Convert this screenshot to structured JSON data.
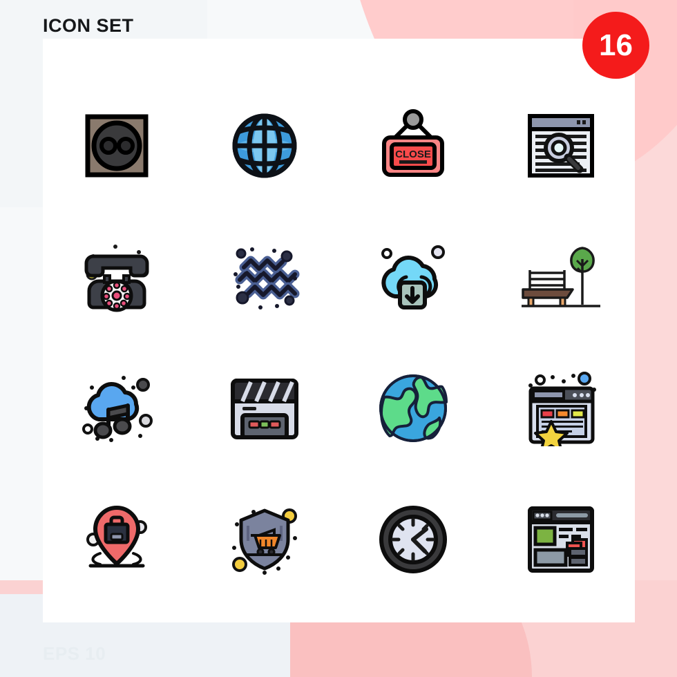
{
  "header": {
    "title": "ICON SET",
    "count_badge": "16",
    "badge_color": "#f41b1b",
    "title_color": "#16181a"
  },
  "footer": {
    "label": "EPS 10",
    "color": "#e7edf1"
  },
  "canvas": {
    "background": "#ffffff",
    "page_background": "#f7f9fa",
    "accent_pink": "#ffc9c9",
    "accent_pink_soft": "#fbd2d2",
    "columns": 4,
    "rows": 4,
    "total_icons": 16
  },
  "icons": [
    {
      "index": 1,
      "name": "power-socket-icon",
      "label": "Power Socket",
      "row": 1,
      "col": 1,
      "colors": [
        "#8a7a6d",
        "#3a3a3c",
        "#000000"
      ]
    },
    {
      "index": 2,
      "name": "globe-grid-icon",
      "label": "Globe",
      "row": 1,
      "col": 2,
      "colors": [
        "#3d9bdc",
        "#7cc8f0",
        "#0d1117"
      ]
    },
    {
      "index": 3,
      "name": "close-sign-icon",
      "label": "Close Sign",
      "row": 1,
      "col": 3,
      "colors": [
        "#fb6f6f",
        "#f94b4b",
        "#8c8c8c"
      ],
      "text": "CLOSE"
    },
    {
      "index": 4,
      "name": "browser-search-icon",
      "label": "Search Website",
      "row": 1,
      "col": 4,
      "colors": [
        "#8e96ad",
        "#eceff4",
        "#c9cee0"
      ]
    },
    {
      "index": 5,
      "name": "retro-telephone-icon",
      "label": "Telephone",
      "row": 2,
      "col": 1,
      "colors": [
        "#3d4048",
        "#e94f7c",
        "#e8e03c"
      ]
    },
    {
      "index": 6,
      "name": "dna-helix-icon",
      "label": "DNA",
      "row": 2,
      "col": 2,
      "colors": [
        "#4a5f93",
        "#1c2033"
      ]
    },
    {
      "index": 7,
      "name": "cloud-download-icon",
      "label": "Cloud Download",
      "row": 2,
      "col": 3,
      "colors": [
        "#74d8f7",
        "#a8c3bb"
      ]
    },
    {
      "index": 8,
      "name": "park-bench-tree-icon",
      "label": "Park Bench",
      "row": 2,
      "col": 4,
      "colors": [
        "#6d4c3d",
        "#e8a76b",
        "#5aa84b"
      ]
    },
    {
      "index": 9,
      "name": "cloud-music-icon",
      "label": "Cloud Music",
      "row": 3,
      "col": 1,
      "colors": [
        "#59a7f0",
        "#4a4a4d"
      ]
    },
    {
      "index": 10,
      "name": "clapperboard-icon",
      "label": "Clapperboard",
      "row": 3,
      "col": 2,
      "colors": [
        "#2b2b30",
        "#d8dce8",
        "#e05a5a",
        "#7cc05a"
      ]
    },
    {
      "index": 11,
      "name": "earth-globe-icon",
      "label": "Earth",
      "row": 3,
      "col": 3,
      "colors": [
        "#3aa6de",
        "#5ddb8a"
      ]
    },
    {
      "index": 12,
      "name": "browser-favorite-icon",
      "label": "Favorite Website",
      "row": 3,
      "col": 4,
      "colors": [
        "#d9e0ef",
        "#f2d33f",
        "#e8404a",
        "#f58a2e",
        "#e2e84a"
      ]
    },
    {
      "index": 13,
      "name": "job-location-pin-icon",
      "label": "Job Location",
      "row": 4,
      "col": 1,
      "colors": [
        "#ef6a6a",
        "#2b3140"
      ]
    },
    {
      "index": 14,
      "name": "shopping-security-icon",
      "label": "Secure Shopping",
      "row": 4,
      "col": 2,
      "colors": [
        "#7b839e",
        "#f0862a",
        "#f3cc3e"
      ]
    },
    {
      "index": 15,
      "name": "clock-icon",
      "label": "Clock",
      "row": 4,
      "col": 3,
      "colors": [
        "#3a3a3c",
        "#dfe3f0"
      ]
    },
    {
      "index": 16,
      "name": "web-layout-icon",
      "label": "Web Layout",
      "row": 4,
      "col": 4,
      "colors": [
        "#d9dfe9",
        "#7cb342",
        "#ef5350",
        "#8d9aa6"
      ]
    }
  ]
}
